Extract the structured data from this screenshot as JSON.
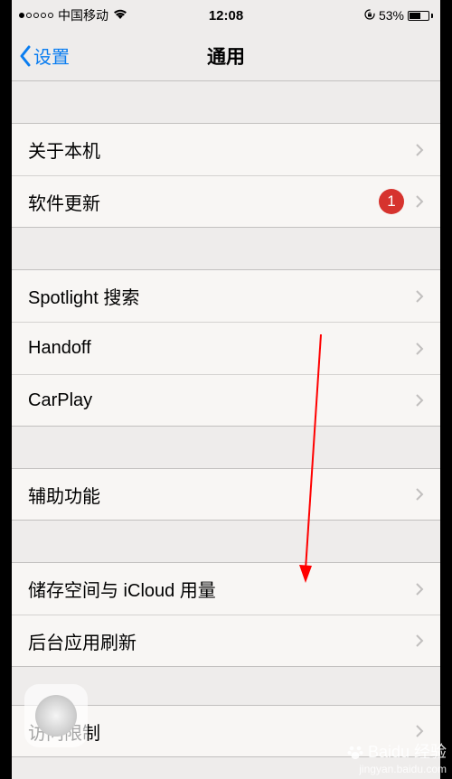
{
  "status": {
    "carrier": "中国移动",
    "time": "12:08",
    "battery_pct": "53%"
  },
  "nav": {
    "back_label": "设置",
    "title": "通用"
  },
  "groups": [
    {
      "cells": [
        {
          "label": "关于本机",
          "badge": null
        },
        {
          "label": "软件更新",
          "badge": "1"
        }
      ]
    },
    {
      "cells": [
        {
          "label": "Spotlight 搜索",
          "badge": null
        },
        {
          "label": "Handoff",
          "badge": null
        },
        {
          "label": "CarPlay",
          "badge": null
        }
      ]
    },
    {
      "cells": [
        {
          "label": "辅助功能",
          "badge": null
        }
      ]
    },
    {
      "cells": [
        {
          "label": "储存空间与 iCloud 用量",
          "badge": null
        },
        {
          "label": "后台应用刷新",
          "badge": null
        }
      ]
    },
    {
      "cells": [
        {
          "label": "访问限制",
          "badge": null
        }
      ]
    }
  ],
  "watermark": {
    "brand": "Baidu 经验",
    "url": "jingyan.baidu.com"
  }
}
